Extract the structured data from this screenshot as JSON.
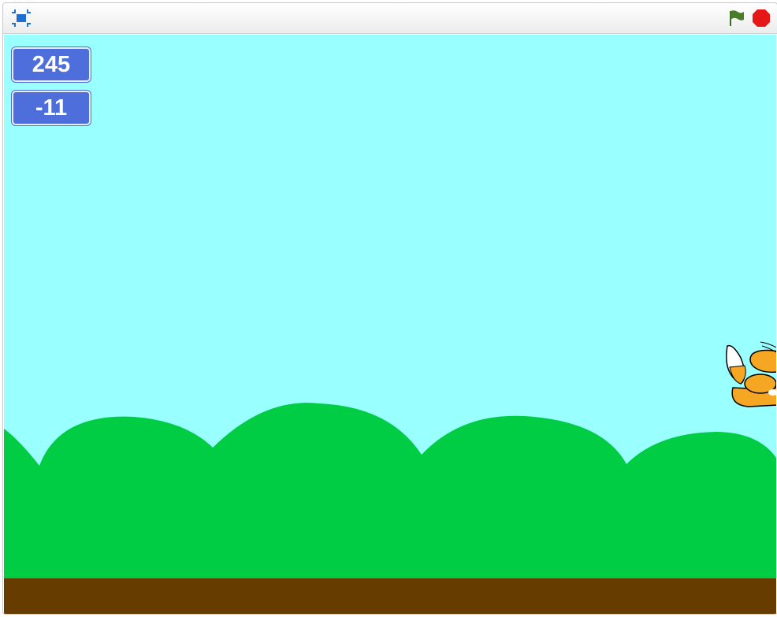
{
  "toolbar": {
    "fullscreen_icon": "fullscreen-icon",
    "green_flag_icon": "green-flag-icon",
    "stop_icon": "stop-sign-icon"
  },
  "stage": {
    "monitors": [
      {
        "value": "245"
      },
      {
        "value": "-11"
      }
    ],
    "colors": {
      "sky": "#99ffff",
      "hills": "#00cc44",
      "ground": "#663c00",
      "monitor": "#4d6edb",
      "flag": "#4a7c2a",
      "stop": "#e51717",
      "toolbar_icon": "#1e6fd1"
    },
    "sprite": "cat-sprite"
  }
}
